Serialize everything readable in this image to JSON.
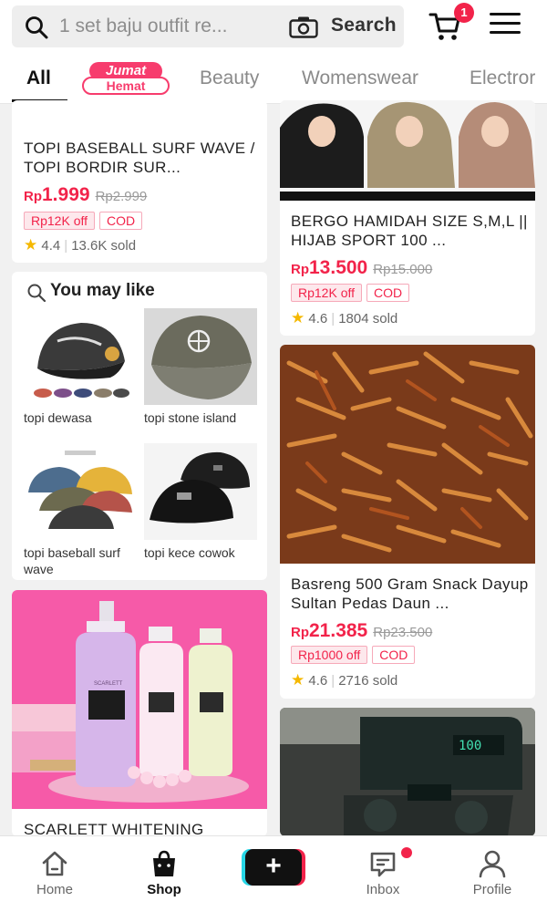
{
  "header": {
    "search_query": "1 set baju outfit re...",
    "search_button": "Search",
    "cart_badge": "1"
  },
  "tabs": [
    {
      "label": "All",
      "active": true
    },
    {
      "label": "Jumat Hemat",
      "badge_top": "Jumat",
      "badge_bottom": "Hemat"
    },
    {
      "label": "Beauty"
    },
    {
      "label": "Womenswear"
    },
    {
      "label": "Electror"
    }
  ],
  "left_column": {
    "card1": {
      "title": "TOPI BASEBALL SURF WAVE / TOPI BORDIR SUR...",
      "currency": "Rp",
      "price": "1.999",
      "old_price": "Rp2.999",
      "tags": [
        "Rp12K off",
        "COD"
      ],
      "rating": "4.4",
      "sold": "13.6K sold"
    },
    "you_may_like": {
      "title": "You may like",
      "items": [
        {
          "label": "topi dewasa"
        },
        {
          "label": "topi stone island"
        },
        {
          "label": "topi baseball surf wave"
        },
        {
          "label": "topi kece cowok"
        }
      ]
    },
    "card3": {
      "title": "SCARLETT WHITENING",
      "image_brand_text": "SCARLETT"
    }
  },
  "right_column": {
    "card1": {
      "title": "BERGO HAMIDAH SIZE S,M,L || HIJAB SPORT 100 ...",
      "currency": "Rp",
      "price": "13.500",
      "old_price": "Rp15.000",
      "tags": [
        "Rp12K off",
        "COD"
      ],
      "rating": "4.6",
      "sold": "1804 sold"
    },
    "card2": {
      "title": "Basreng 500 Gram Snack Dayup Sultan Pedas Daun ...",
      "currency": "Rp",
      "price": "21.385",
      "old_price": "Rp23.500",
      "tags": [
        "Rp1000 off",
        "COD"
      ],
      "rating": "4.6",
      "sold": "2716 sold"
    },
    "card3": {
      "image_display_text": "100"
    }
  },
  "bottom_nav": [
    {
      "label": "Home",
      "icon": "home-icon"
    },
    {
      "label": "Shop",
      "icon": "shop-bag-icon",
      "active": true
    },
    {
      "label": "",
      "icon": "plus-icon"
    },
    {
      "label": "Inbox",
      "icon": "inbox-icon",
      "has_dot": true
    },
    {
      "label": "Profile",
      "icon": "profile-icon"
    }
  ],
  "colors": {
    "accent": "#f2234a",
    "rating_star": "#f5b800",
    "jumat_pink": "#f73c6d"
  }
}
